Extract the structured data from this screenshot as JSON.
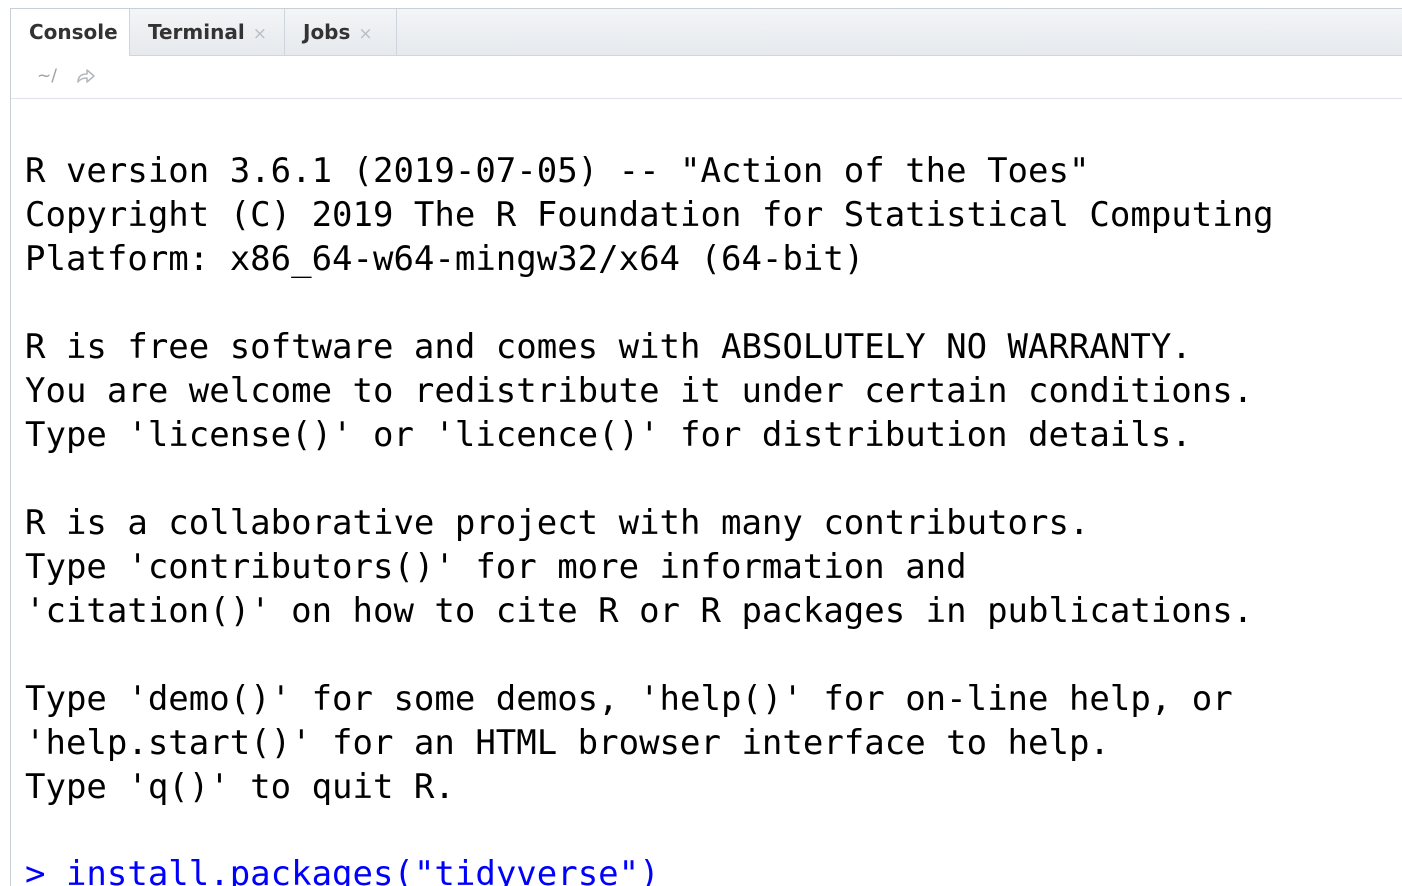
{
  "tabs": [
    {
      "label": "Console",
      "active": true,
      "closable": false
    },
    {
      "label": "Terminal",
      "active": false,
      "closable": true
    },
    {
      "label": "Jobs",
      "active": false,
      "closable": true
    }
  ],
  "tab_close_glyph": "×",
  "path": {
    "text": "~/",
    "icon": "go-to-directory-icon"
  },
  "console": {
    "lines": [
      "R version 3.6.1 (2019-07-05) -- \"Action of the Toes\"",
      "Copyright (C) 2019 The R Foundation for Statistical Computing",
      "Platform: x86_64-w64-mingw32/x64 (64-bit)",
      "",
      "R is free software and comes with ABSOLUTELY NO WARRANTY.",
      "You are welcome to redistribute it under certain conditions.",
      "Type 'license()' or 'licence()' for distribution details.",
      "",
      "R is a collaborative project with many contributors.",
      "Type 'contributors()' for more information and",
      "'citation()' on how to cite R or R packages in publications.",
      "",
      "Type 'demo()' for some demos, 'help()' for on-line help, or",
      "'help.start()' for an HTML browser interface to help.",
      "Type 'q()' to quit R.",
      ""
    ],
    "prompt": "> ",
    "command": "install.packages(\"tidyverse\")"
  },
  "colors": {
    "output_text": "#000000",
    "command_text": "#0000ff",
    "tab_bar_bg": "#e6e9ed",
    "muted": "#9aa0a6"
  }
}
